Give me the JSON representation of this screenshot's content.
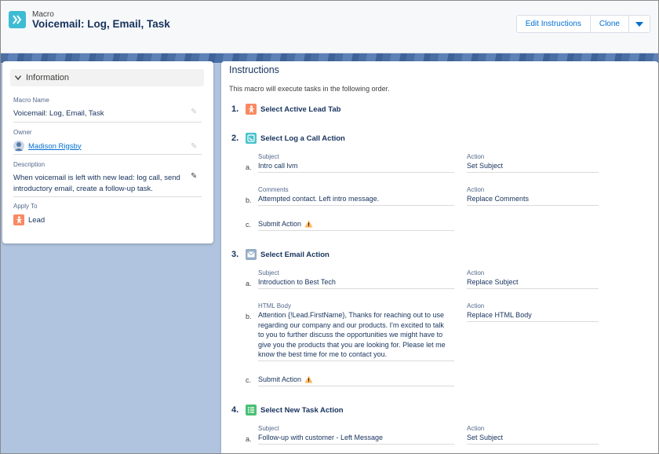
{
  "header": {
    "object_label": "Macro",
    "title": "Voicemail: Log, Email, Task",
    "actions": [
      "Edit Instructions",
      "Clone"
    ]
  },
  "information": {
    "section_title": "Information",
    "fields": {
      "macro_name_label": "Macro Name",
      "macro_name": "Voicemail: Log, Email, Task",
      "owner_label": "Owner",
      "owner": "Madison Rigsby",
      "description_label": "Description",
      "description": "When voicemail is left with new lead: log call, send introductory email, create a follow-up task.",
      "apply_to_label": "Apply To",
      "apply_to": "Lead"
    }
  },
  "instructions": {
    "title": "Instructions",
    "description": "This macro will execute tasks in the following order.",
    "steps": [
      {
        "number": "1.",
        "title": "Select Active Lead Tab"
      },
      {
        "number": "2.",
        "title": "Select Log a Call Action",
        "subs": [
          {
            "letter": "a.",
            "field_label": "Subject",
            "field_value": "Intro call lvm",
            "action_label": "Action",
            "action_value": "Set Subject"
          },
          {
            "letter": "b.",
            "field_label": "Comments",
            "field_value": "Attempted contact. Left intro message.",
            "action_label": "Action",
            "action_value": "Replace Comments"
          },
          {
            "letter": "c.",
            "field_value": "Submit Action"
          }
        ]
      },
      {
        "number": "3.",
        "title": "Select Email Action",
        "subs": [
          {
            "letter": "a.",
            "field_label": "Subject",
            "field_value": "Introduction to Best Tech",
            "action_label": "Action",
            "action_value": "Replace Subject"
          },
          {
            "letter": "b.",
            "field_label": "HTML Body",
            "field_value_lines": [
              "Attention {!Lead.FirstName}, Thanks for reaching out to use",
              "regarding our company and our products. I'm excited to talk",
              "to you to further discuss the opportunities we might have to",
              "give you the products that you are looking for. Please let me",
              "know the best time for me to contact you."
            ],
            "action_label": "Action",
            "action_value": "Replace HTML Body"
          },
          {
            "letter": "c.",
            "field_value": "Submit Action"
          }
        ]
      },
      {
        "number": "4.",
        "title": "Select New Task Action",
        "subs": [
          {
            "letter": "a.",
            "field_label": "Subject",
            "field_value": "Follow-up with customer - Left Message",
            "action_label": "Action",
            "action_value": "Set Subject"
          }
        ]
      }
    ]
  },
  "colors": {
    "lead_orange": "#f88962",
    "log_call_teal": "#48c3cc",
    "email_gray": "#95aec5",
    "task_green": "#4bc076",
    "macro_blue": "#3dbcd3",
    "warning": "#ffb75d"
  },
  "icons": {
    "macro": "chevron-forward-icon",
    "lead": "person-icon",
    "log_call": "phone-log-icon",
    "email": "envelope-icon",
    "task": "checklist-icon",
    "warning": "warning-triangle-icon",
    "edit": "pencil-icon",
    "owner_avatar": "avatar"
  }
}
